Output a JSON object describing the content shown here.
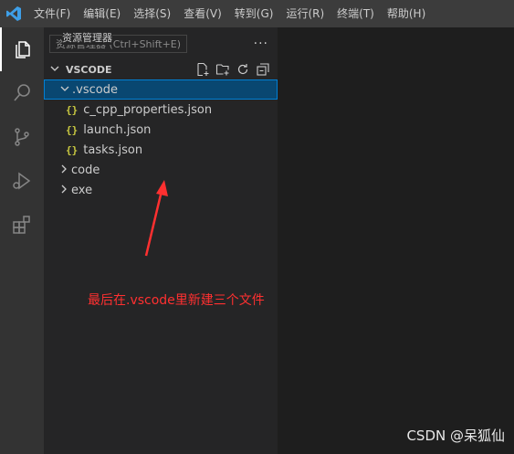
{
  "menu": [
    "文件(F)",
    "编辑(E)",
    "选择(S)",
    "查看(V)",
    "转到(G)",
    "运行(R)",
    "终端(T)",
    "帮助(H)"
  ],
  "explorer": {
    "title": "资源管理器",
    "tooltip": "资源管理器 (Ctrl+Shift+E)",
    "more": "···",
    "folder": "VSCODE",
    "tree": [
      {
        "label": ".vscode",
        "type": "folder",
        "expanded": true,
        "selected": true,
        "depth": 0
      },
      {
        "label": "c_cpp_properties.json",
        "type": "json",
        "depth": 1
      },
      {
        "label": "launch.json",
        "type": "json",
        "depth": 1
      },
      {
        "label": "tasks.json",
        "type": "json",
        "depth": 1
      },
      {
        "label": "code",
        "type": "folder",
        "expanded": false,
        "depth": 0
      },
      {
        "label": "exe",
        "type": "folder",
        "expanded": false,
        "depth": 0
      }
    ]
  },
  "json_icon": "{}",
  "annotation": "最后在.vscode里新建三个文件",
  "watermark": "CSDN @呆狐仙",
  "colors": {
    "accent": "#007acc",
    "selection": "#094771",
    "annotation": "#ff3030",
    "json_icon": "#cbcb41"
  }
}
